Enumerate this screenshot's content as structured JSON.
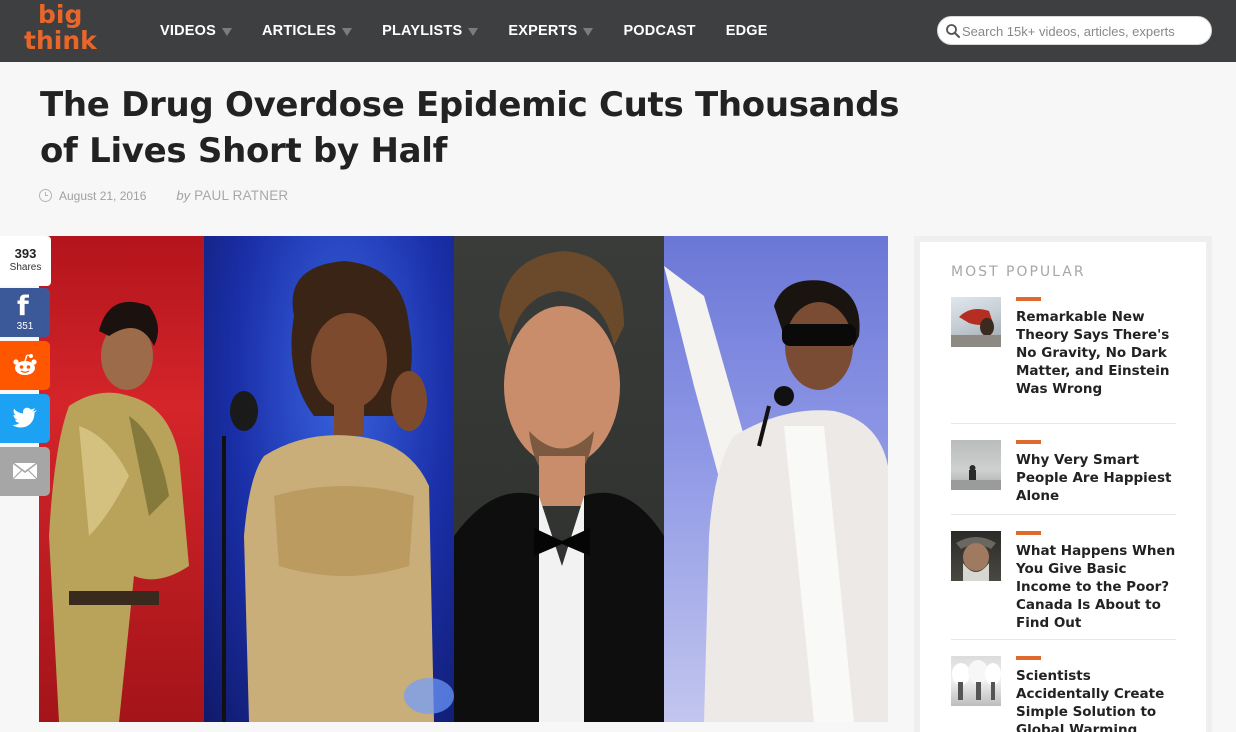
{
  "header": {
    "logo_line1": "big",
    "logo_line2": "think",
    "nav": [
      {
        "label": "VIDEOS",
        "has_menu": true
      },
      {
        "label": "ARTICLES",
        "has_menu": true
      },
      {
        "label": "PLAYLISTS",
        "has_menu": true
      },
      {
        "label": "EXPERTS",
        "has_menu": true
      },
      {
        "label": "PODCAST",
        "has_menu": false
      },
      {
        "label": "EDGE",
        "has_menu": false
      }
    ],
    "search": {
      "placeholder": "Search 15k+ videos, articles, experts",
      "value": "",
      "icon": "search-icon"
    }
  },
  "article": {
    "title": "The Drug Overdose Epidemic Cuts Thousands of Lives Short by Half",
    "date": "August 21, 2016",
    "by": "by",
    "author": "PAUL RATNER",
    "image_icon": "collage-photo"
  },
  "share": {
    "count": "393",
    "count_label": "Shares",
    "facebook_glyph": "f",
    "facebook_count": "351",
    "buttons": [
      "facebook-icon",
      "reddit-icon",
      "twitter-icon",
      "email-icon"
    ]
  },
  "sidebar": {
    "heading": "MOST POPULAR",
    "items": [
      {
        "title": "Remarkable New Theory Says There's No Gravity, No Dark Matter, and Einstein Was Wrong"
      },
      {
        "title": "Why Very Smart People Are Happiest Alone"
      },
      {
        "title": "What Happens When You Give Basic Income to the Poor? Canada Is About to Find Out"
      },
      {
        "title": "Scientists Accidentally Create Simple Solution to Global Warming"
      }
    ]
  },
  "colors": {
    "header_bg": "#3d3f41",
    "brand_orange": "#e8662a",
    "facebook": "#3b5998",
    "reddit": "#ff5700",
    "twitter": "#1da1f2",
    "email": "#a6a6a6"
  }
}
